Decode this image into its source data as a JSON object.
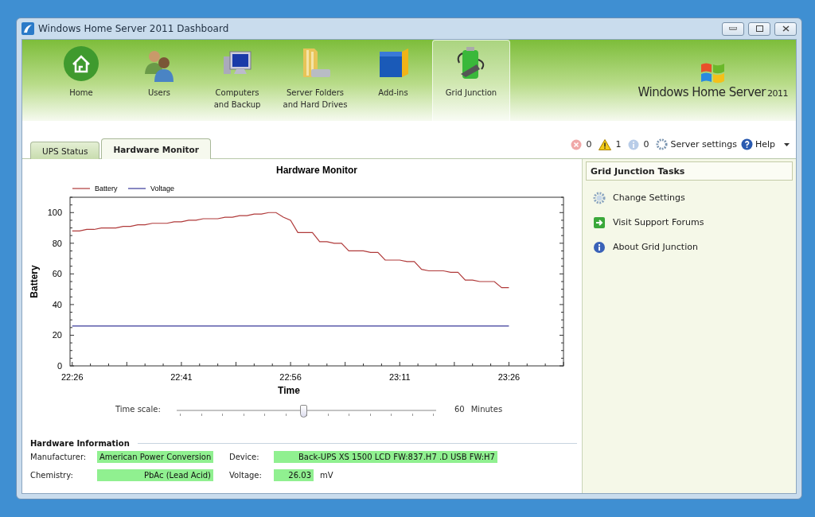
{
  "window": {
    "title": "Windows Home Server 2011 Dashboard"
  },
  "nav": [
    {
      "label": "Home",
      "kind": "home",
      "selected": false
    },
    {
      "label": "Users",
      "kind": "users",
      "selected": false
    },
    {
      "label": "Computers\nand Backup",
      "kind": "computer",
      "selected": false
    },
    {
      "label": "Server Folders\nand Hard Drives",
      "kind": "folder",
      "selected": false
    },
    {
      "label": "Add-ins",
      "kind": "addin",
      "selected": false
    },
    {
      "label": "Grid Junction",
      "kind": "battery",
      "selected": true
    }
  ],
  "brand": {
    "name": "Windows Home Server",
    "version": "2011"
  },
  "tabs": [
    {
      "label": "UPS Status",
      "selected": false
    },
    {
      "label": "Hardware Monitor",
      "selected": true
    }
  ],
  "status": {
    "errors": "0",
    "warnings": "1",
    "infos": "0",
    "settings": "Server settings",
    "help": "Help"
  },
  "chart": {
    "chart_data": {
      "type": "line",
      "title": "Hardware Monitor",
      "xlabel": "Time",
      "ylabel": "Battery",
      "legend": "top-left",
      "ylim": [
        0,
        110
      ],
      "yticks": [
        0,
        20,
        40,
        60,
        80,
        100
      ],
      "categories": [
        "22:26",
        null,
        null,
        null,
        null,
        null,
        null,
        null,
        null,
        null,
        null,
        null,
        null,
        null,
        null,
        "22:41",
        null,
        null,
        null,
        null,
        null,
        null,
        null,
        null,
        null,
        null,
        null,
        null,
        null,
        null,
        "22:56",
        null,
        null,
        null,
        null,
        null,
        null,
        null,
        null,
        null,
        null,
        null,
        null,
        null,
        null,
        "23:11",
        null,
        null,
        null,
        null,
        null,
        null,
        null,
        null,
        null,
        null,
        null,
        null,
        null,
        null,
        "23:26"
      ],
      "series": [
        {
          "name": "Battery",
          "color": "#b03a3a",
          "values": [
            88,
            88,
            89,
            89,
            90,
            90,
            90,
            91,
            91,
            92,
            92,
            93,
            93,
            93,
            94,
            94,
            95,
            95,
            96,
            96,
            96,
            97,
            97,
            98,
            98,
            99,
            99,
            100,
            100,
            97,
            95,
            87,
            87,
            87,
            81,
            81,
            80,
            80,
            75,
            75,
            75,
            74,
            74,
            69,
            69,
            69,
            68,
            68,
            63,
            62,
            62,
            62,
            61,
            61,
            56,
            56,
            55,
            55,
            55,
            51,
            51
          ]
        },
        {
          "name": "Voltage",
          "color": "#3a3a9a",
          "values": [
            26,
            26,
            26,
            26,
            26,
            26,
            26,
            26,
            26,
            26,
            26,
            26,
            26,
            26,
            26,
            26,
            26,
            26,
            26,
            26,
            26,
            26,
            26,
            26,
            26,
            26,
            26,
            26,
            26,
            26,
            26,
            26,
            26,
            26,
            26,
            26,
            26,
            26,
            26,
            26,
            26,
            26,
            26,
            26,
            26,
            26,
            26,
            26,
            26,
            26,
            26,
            26,
            26,
            26,
            26,
            26,
            26,
            26,
            26,
            26,
            26
          ]
        }
      ]
    }
  },
  "time_scale": {
    "label": "Time scale:",
    "level": 0.49,
    "value": "60",
    "unit": "Minutes"
  },
  "hardware_info": {
    "title": "Hardware Information",
    "fields": [
      {
        "label": "Manufacturer:",
        "value": "American Power Conversion"
      },
      {
        "label": "Device:",
        "value": "Back-UPS XS 1500 LCD FW:837.H7 .D USB FW:H7"
      },
      {
        "label": "Chemistry:",
        "value": "PbAc (Lead Acid)"
      },
      {
        "label": "Voltage:",
        "value": "26.03",
        "unit": "mV"
      }
    ]
  },
  "tasks": {
    "title": "Grid Junction Tasks",
    "items": [
      {
        "label": "Change Settings",
        "kind": "gear"
      },
      {
        "label": "Visit Support Forums",
        "kind": "arrow"
      },
      {
        "label": "About Grid Junction",
        "kind": "info"
      }
    ]
  }
}
